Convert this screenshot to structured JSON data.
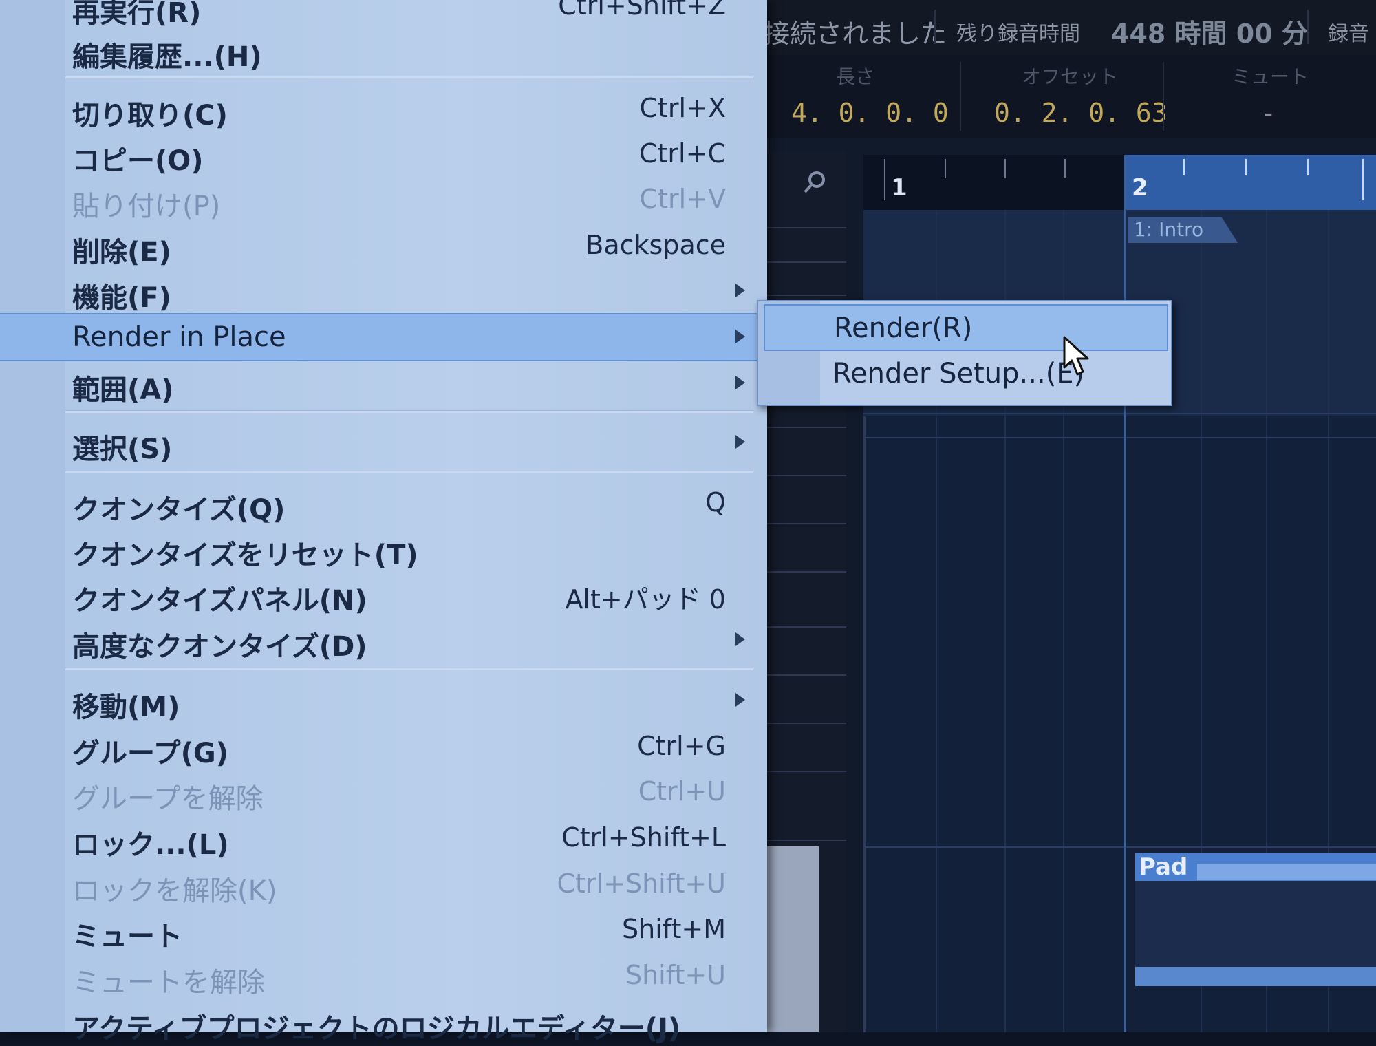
{
  "status_bar": {
    "left_text": "接続されました",
    "remaining_label": "残り録音時間",
    "remaining_value": "448 時間 00 分",
    "right_text": "録音"
  },
  "info_line": {
    "length_label": "長さ",
    "length_value": "4. 0. 0.  0",
    "offset_label": "オフセット",
    "offset_value": "0. 2. 0. 63",
    "mute_label": "ミュート",
    "mute_value": "-"
  },
  "ruler": {
    "bar1": "1",
    "bar2": "2"
  },
  "markers": {
    "intro": "1: Intro"
  },
  "events": {
    "pad": "Pad"
  },
  "menu": {
    "items": [
      {
        "label": "再実行(R)",
        "shortcut": "Ctrl+Shift+Z",
        "disabled": false
      },
      {
        "label": "編集履歴...(H)",
        "shortcut": ""
      },
      {
        "label": "切り取り(C)",
        "shortcut": "Ctrl+X"
      },
      {
        "label": "コピー(O)",
        "shortcut": "Ctrl+C"
      },
      {
        "label": "貼り付け(P)",
        "shortcut": "Ctrl+V",
        "disabled": true
      },
      {
        "label": "削除(E)",
        "shortcut": "Backspace"
      },
      {
        "label": "機能(F)",
        "shortcut": ""
      },
      {
        "label": "Render in Place",
        "shortcut": ""
      },
      {
        "label": "範囲(A)",
        "shortcut": ""
      },
      {
        "label": "選択(S)",
        "shortcut": ""
      },
      {
        "label": "クオンタイズ(Q)",
        "shortcut": "Q"
      },
      {
        "label": "クオンタイズをリセット(T)",
        "shortcut": ""
      },
      {
        "label": "クオンタイズパネル(N)",
        "shortcut": "Alt+パッド 0"
      },
      {
        "label": "高度なクオンタイズ(D)",
        "shortcut": ""
      },
      {
        "label": "移動(M)",
        "shortcut": ""
      },
      {
        "label": "グループ(G)",
        "shortcut": "Ctrl+G"
      },
      {
        "label": "グループを解除",
        "shortcut": "Ctrl+U",
        "disabled": true
      },
      {
        "label": "ロック...(L)",
        "shortcut": "Ctrl+Shift+L"
      },
      {
        "label": "ロックを解除(K)",
        "shortcut": "Ctrl+Shift+U",
        "disabled": true
      },
      {
        "label": "ミュート",
        "shortcut": "Shift+M"
      },
      {
        "label": "ミュートを解除",
        "shortcut": "Shift+U",
        "disabled": true
      },
      {
        "label": "アクティブプロジェクトのロジカルエディター(J)",
        "shortcut": ""
      }
    ]
  },
  "submenu": {
    "items": [
      {
        "label": "Render(R)"
      },
      {
        "label": "Render Setup...(E)"
      }
    ]
  },
  "colors": {
    "menu_bg": "#b9cfeb",
    "highlight": "#8eb6ea",
    "arranger_bg": "#13203a",
    "counter_text": "#c2a85a"
  }
}
